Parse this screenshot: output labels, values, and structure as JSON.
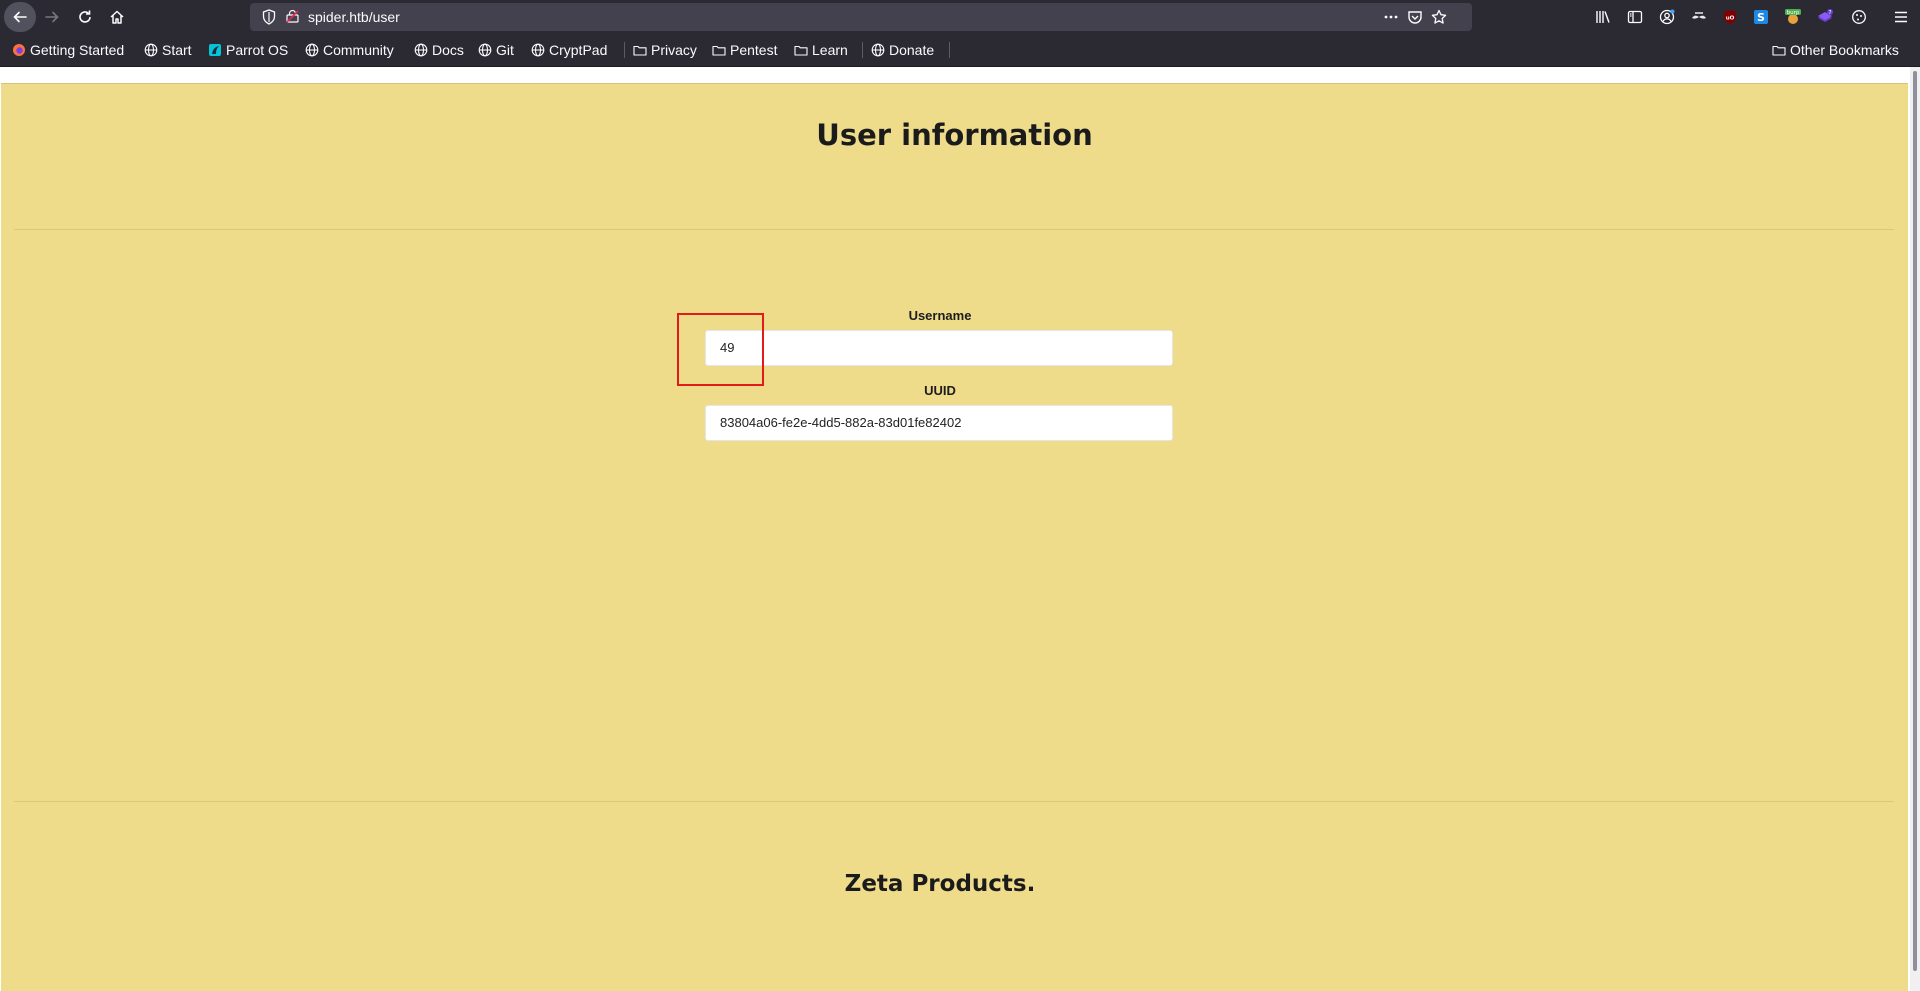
{
  "browser": {
    "url": "spider.htb/user",
    "icons": {
      "back": "arrow-left-icon",
      "forward": "arrow-right-icon",
      "reload": "reload-icon",
      "home": "home-icon",
      "tracking": "shield-icon",
      "page_actions": "ellipsis-icon",
      "pocket": "pocket-icon",
      "bookmark": "star-icon",
      "library": "library-icon",
      "sidebar": "sidebar-icon",
      "account": "account-icon",
      "menu": "hamburger-icon"
    },
    "extensions": [
      "library-icon",
      "sidebar-icon",
      "account-icon",
      "ext-mustache-icon",
      "ublock-icon",
      "ext-s-icon",
      "burp-icon",
      "ext-purple-icon",
      "cookie-icon",
      "hamburger-icon"
    ],
    "extension_badges": {
      "burp": "burp",
      "purple": "7"
    }
  },
  "bookmarks": {
    "items": [
      {
        "label": "Getting Started",
        "icon": "firefox-icon"
      },
      {
        "label": "Start",
        "icon": "globe-icon"
      },
      {
        "label": "Parrot OS",
        "icon": "parrot-icon"
      },
      {
        "label": "Community",
        "icon": "globe-icon"
      },
      {
        "label": "Docs",
        "icon": "globe-icon"
      },
      {
        "label": "Git",
        "icon": "globe-icon"
      },
      {
        "label": "CryptPad",
        "icon": "globe-icon"
      },
      {
        "label": "Privacy",
        "icon": "folder-icon"
      },
      {
        "label": "Pentest",
        "icon": "folder-icon"
      },
      {
        "label": "Learn",
        "icon": "folder-icon"
      },
      {
        "label": "Donate",
        "icon": "globe-icon"
      }
    ],
    "other": {
      "label": "Other Bookmarks",
      "icon": "folder-icon"
    }
  },
  "page": {
    "background": "#eedc8a",
    "title": "User information",
    "username_label": "Username",
    "username_value": "49",
    "uuid_label": "UUID",
    "uuid_value": "83804a06-fe2e-4dd5-882a-83d01fe82402",
    "footer_title": "Zeta Products.",
    "highlight_color": "#e41b1b"
  }
}
